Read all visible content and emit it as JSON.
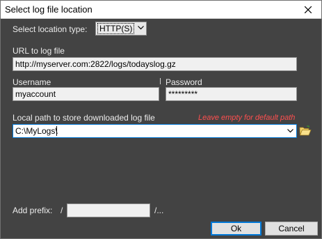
{
  "window": {
    "title": "Select log file location",
    "close_icon": "close-icon"
  },
  "location_type": {
    "label": "Select location type:",
    "selected": "HTTP(S)"
  },
  "url": {
    "label": "URL to log file",
    "value": "http://myserver.com:2822/logs/todayslog.gz"
  },
  "username": {
    "label": "Username",
    "value": "myaccount"
  },
  "password": {
    "label": "Password",
    "value": "*********"
  },
  "local_path": {
    "label": "Local path to store downloaded log file",
    "hint": "Leave empty for default path",
    "value": "C:\\MyLogs\\",
    "browse_icon": "folder-open-icon"
  },
  "prefix": {
    "label": "Add prefix:",
    "slash": "/",
    "value": "",
    "suffix": "/..."
  },
  "buttons": {
    "ok": "Ok",
    "cancel": "Cancel"
  },
  "colors": {
    "background": "#434343",
    "hint": "#ff4f4f",
    "focus": "#0078d7"
  }
}
